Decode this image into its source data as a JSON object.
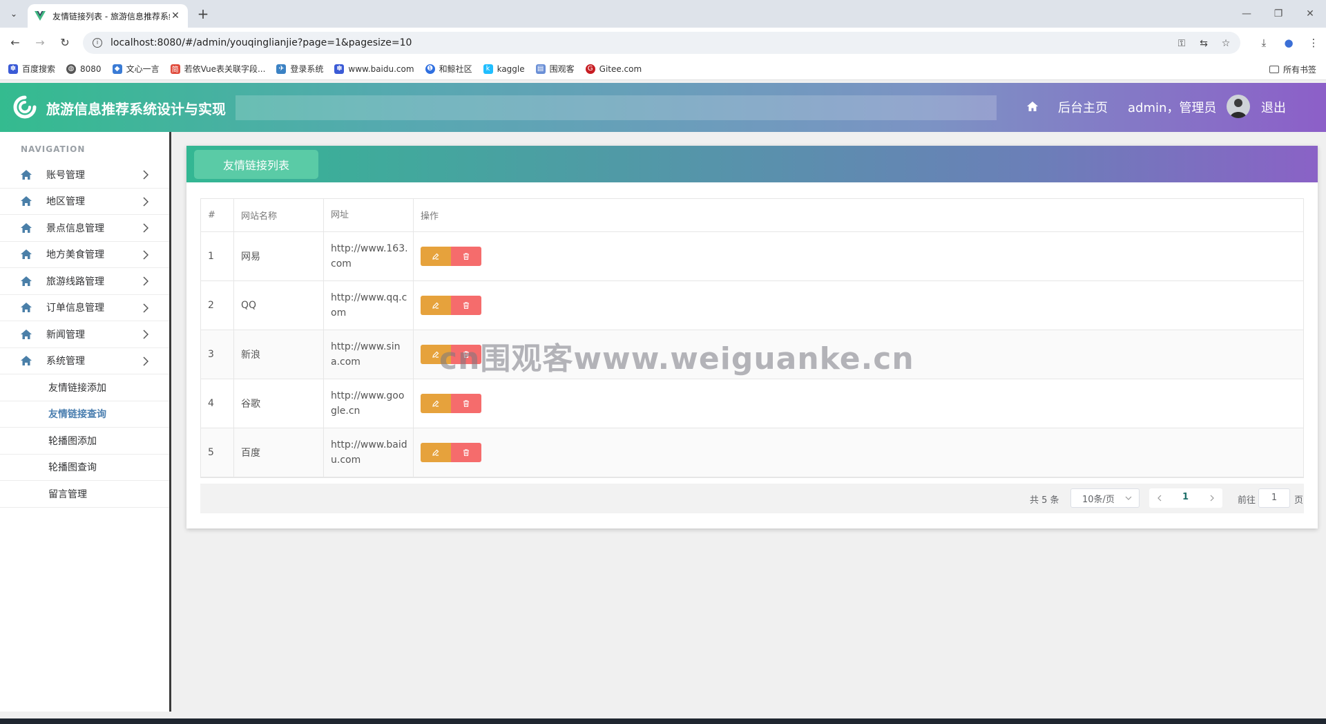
{
  "browser": {
    "tab_title": "友情链接列表 - 旅游信息推荐系统设计与实现",
    "url": "localhost:8080/#/admin/youqinglianjie?page=1&pagesize=10",
    "bookmarks": [
      {
        "label": "百度搜索",
        "icon": "baidu-paw-icon",
        "color": "#3b5bd6"
      },
      {
        "label": "8080",
        "icon": "globe-icon",
        "color": "#555555"
      },
      {
        "label": "文心一言",
        "icon": "wenxin-icon",
        "color": "#3a7bd5"
      },
      {
        "label": "若依Vue表关联字段...",
        "icon": "jian-icon",
        "color": "#e04b3c"
      },
      {
        "label": "登录系统",
        "icon": "bird-icon",
        "color": "#3b82c4"
      },
      {
        "label": "www.baidu.com",
        "icon": "baidu-paw-icon",
        "color": "#3b5bd6"
      },
      {
        "label": "和鲸社区",
        "icon": "heywhale-icon",
        "color": "#2f6fe0"
      },
      {
        "label": "kaggle",
        "icon": "kaggle-icon",
        "color": "#20beff"
      },
      {
        "label": "围观客",
        "icon": "weiguanke-icon",
        "color": "#6a8fd6"
      },
      {
        "label": "Gitee.com",
        "icon": "gitee-icon",
        "color": "#c71d23"
      }
    ],
    "all_bookmarks": "所有书签"
  },
  "header": {
    "title": "旅游信息推荐系统设计与实现",
    "home_link": "后台主页",
    "user": "admin，管理员",
    "logout": "退出"
  },
  "sidebar": {
    "caption": "NAVIGATION",
    "menus": [
      {
        "label": "账号管理"
      },
      {
        "label": "地区管理"
      },
      {
        "label": "景点信息管理"
      },
      {
        "label": "地方美食管理"
      },
      {
        "label": "旅游线路管理"
      },
      {
        "label": "订单信息管理"
      },
      {
        "label": "新闻管理"
      },
      {
        "label": "系统管理"
      }
    ],
    "submenus": [
      {
        "label": "友情链接添加",
        "active": false
      },
      {
        "label": "友情链接查询",
        "active": true
      },
      {
        "label": "轮播图添加",
        "active": false
      },
      {
        "label": "轮播图查询",
        "active": false
      },
      {
        "label": "留言管理",
        "active": false
      }
    ]
  },
  "panel": {
    "tab": "友情链接列表",
    "columns": [
      "#",
      "网站名称",
      "网址",
      "操作"
    ],
    "rows": [
      {
        "idx": "1",
        "name": "网易",
        "url": "http://www.163.com"
      },
      {
        "idx": "2",
        "name": "QQ",
        "url": "http://www.qq.com"
      },
      {
        "idx": "3",
        "name": "新浪",
        "url": "http://www.sina.com"
      },
      {
        "idx": "4",
        "name": "谷歌",
        "url": "http://www.google.cn"
      },
      {
        "idx": "5",
        "name": "百度",
        "url": "http://www.baidu.com"
      }
    ],
    "pagination": {
      "total": "共 5 条",
      "page_size": "10条/页",
      "current_page": "1",
      "goto_label": "前往",
      "goto_value": "1",
      "page_suffix": "页"
    }
  },
  "watermark": "cn围观客www.weiguanke.cn",
  "colors": {
    "edit": "#e6a23c",
    "delete": "#f56c6c",
    "active_menu": "#4b7fb0"
  }
}
